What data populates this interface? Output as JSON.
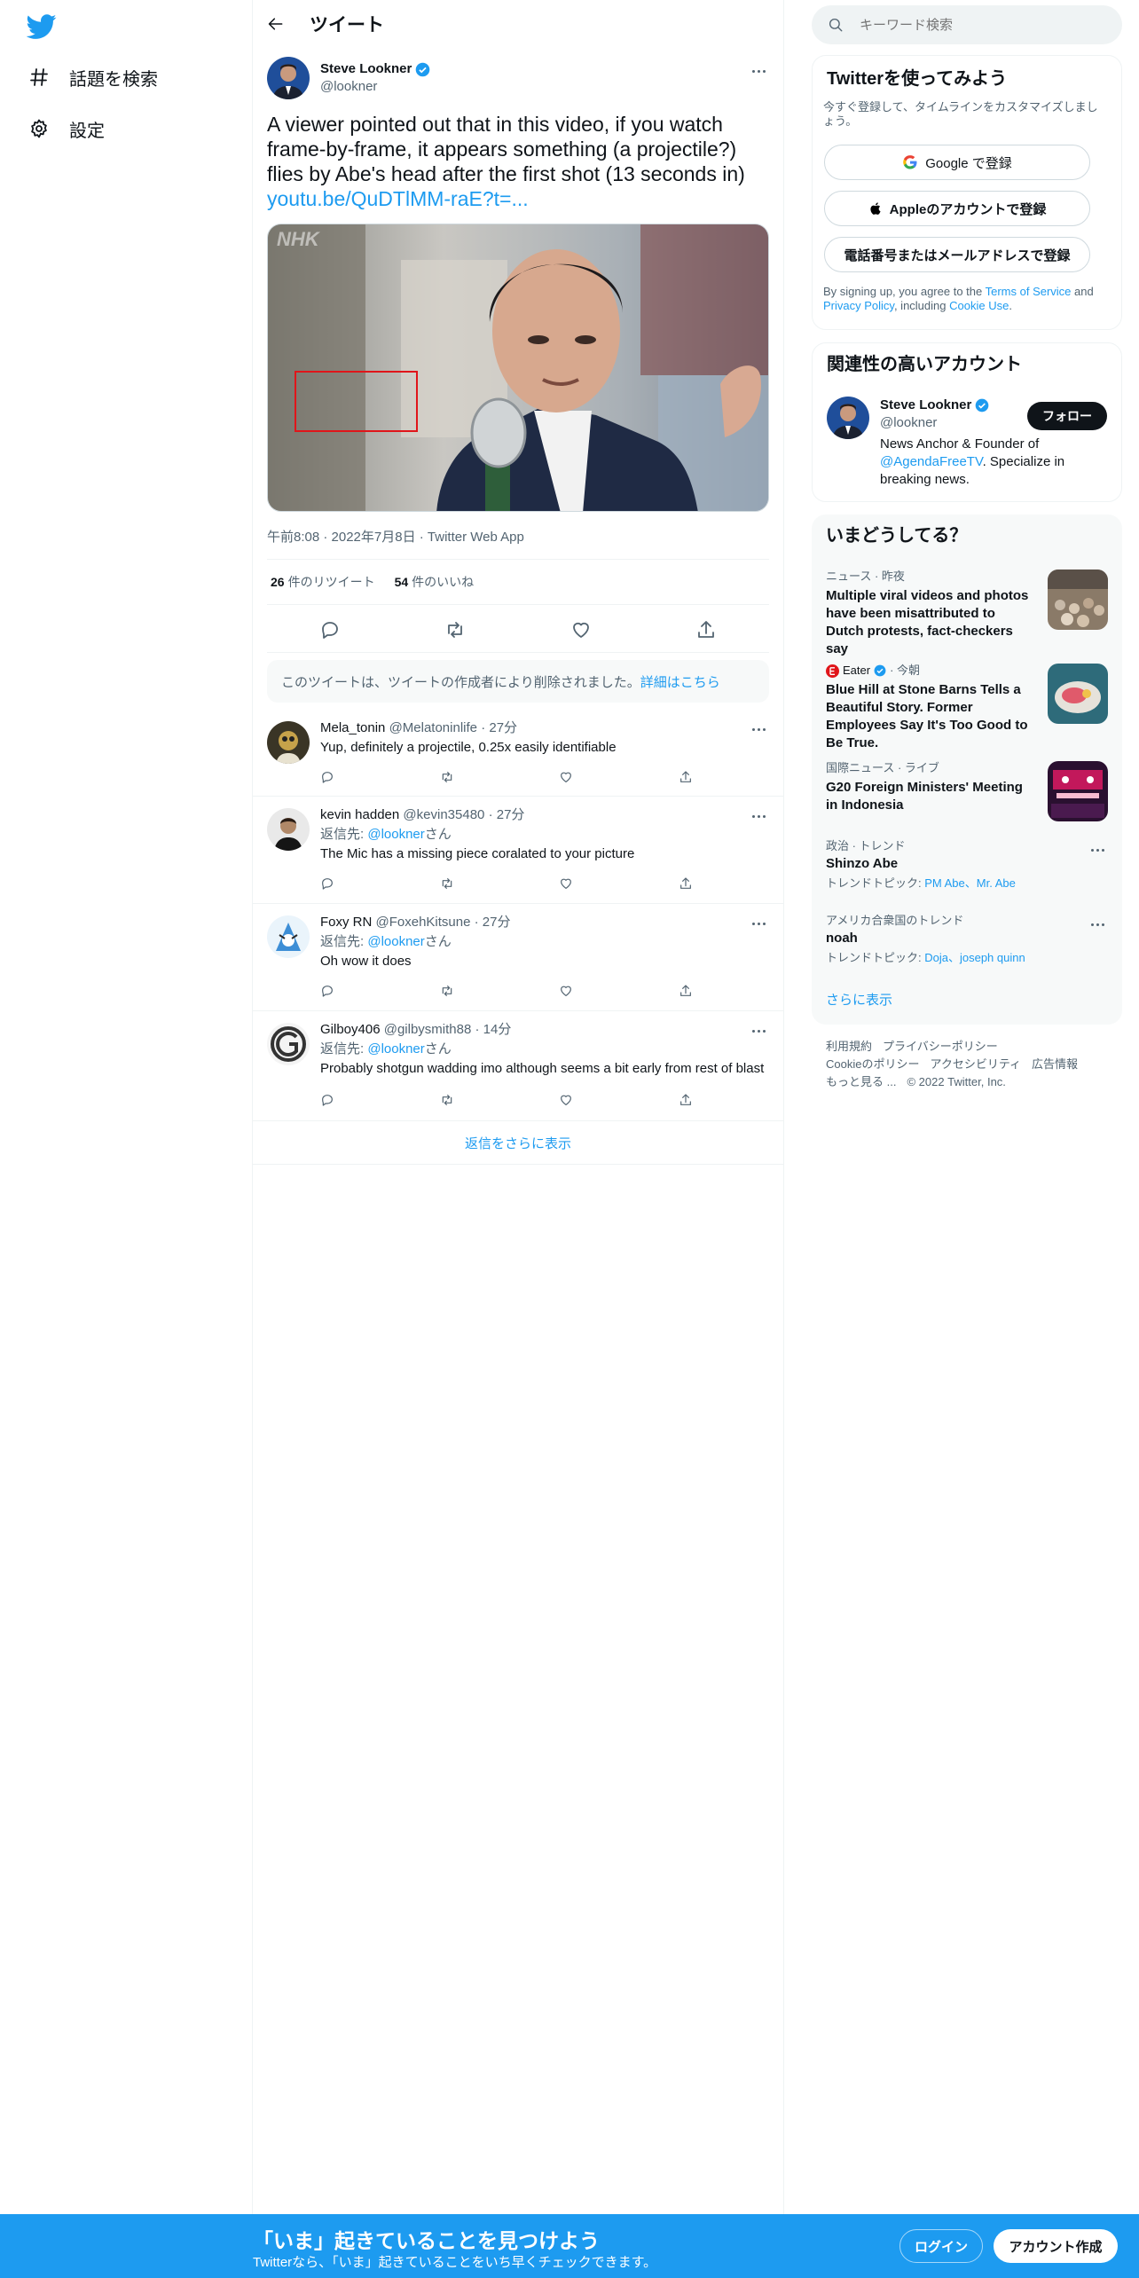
{
  "nav": {
    "explore_label": "話題を検索",
    "settings_label": "設定"
  },
  "header": {
    "title": "ツイート"
  },
  "tweet": {
    "author_name": "Steve Lookner",
    "author_handle": "@lookner",
    "text": "A viewer pointed out that in this video, if you watch frame-by-frame, it appears something (a projectile?) flies by Abe's head after the first shot (13 seconds in)",
    "link": "youtu.be/QuDTlMM-raE?t=...",
    "media_watermark": "NHK",
    "timestamp": "午前8:08 · 2022年7月8日 · Twitter Web App",
    "retweets_count": "26",
    "retweets_label": "件のリツイート",
    "likes_count": "54",
    "likes_label": "件のいいね"
  },
  "deleted_notice": {
    "text": "このツイートは、ツイートの作成者により削除されました。",
    "link": "詳細はこちら"
  },
  "replies": [
    {
      "name": "Mela_tonin",
      "handle": "@Melatoninlife",
      "time": "· 27分",
      "reply_to": "",
      "text": "Yup, definitely a projectile, 0.25x easily identifiable"
    },
    {
      "name": "kevin hadden",
      "handle": "@kevin35480",
      "time": "· 27分",
      "reply_to_prefix": "返信先: ",
      "reply_to": "@lookner",
      "reply_to_suffix": "さん",
      "text": "The Mic has a missing piece  coralated to your picture"
    },
    {
      "name": "Foxy RN",
      "handle": "@FoxehKitsune",
      "time": "· 27分",
      "reply_to_prefix": "返信先: ",
      "reply_to": "@lookner",
      "reply_to_suffix": "さん",
      "text": "Oh wow it does"
    },
    {
      "name": "Gilboy406",
      "handle": "@gilbysmith88",
      "time": "· 14分",
      "reply_to_prefix": "返信先: ",
      "reply_to": "@lookner",
      "reply_to_suffix": "さん",
      "text": "Probably shotgun wadding imo although seems a bit early from rest of blast"
    }
  ],
  "more_replies": "返信をさらに表示",
  "search": {
    "placeholder": "キーワード検索"
  },
  "signup_panel": {
    "title": "Twitterを使ってみよう",
    "subtitle": "今すぐ登録して、タイムラインをカスタマイズしましょう。",
    "google": "Google で登録",
    "apple": "Appleのアカウントで登録",
    "phone": "電話番号またはメールアドレスで登録",
    "terms_1": "By signing up, you agree to the ",
    "terms_link": "Terms of Service",
    "terms_2": " and ",
    "privacy_link": "Privacy Policy",
    "terms_3": ", including ",
    "cookie_link": "Cookie Use",
    "terms_4": "."
  },
  "relevant": {
    "title": "関連性の高いアカウント",
    "name": "Steve Lookner",
    "handle": "@lookner",
    "follow": "フォロー",
    "bio_1": "News Anchor & Founder of ",
    "bio_link": "@AgendaFreeTV",
    "bio_2": ". Specialize in breaking news."
  },
  "trends": {
    "title": "いまどうしてる？",
    "items": [
      {
        "context": "ニュース · 昨夜",
        "title": "Multiple viral videos and photos have been misattributed to Dutch protests, fact-checkers say"
      },
      {
        "context_source": "Eater",
        "context": " · 今朝",
        "title": "Blue Hill at Stone Barns Tells a Beautiful Story. Former Employees Say It's Too Good to Be True."
      },
      {
        "context": "国際ニュース · ライブ",
        "title": "G20 Foreign Ministers' Meeting in Indonesia"
      },
      {
        "context": "政治 · トレンド",
        "title": "Shinzo Abe",
        "topics_label": "トレンドトピック: ",
        "topics": "PM Abe、Mr. Abe"
      },
      {
        "context": "アメリカ合衆国のトレンド",
        "title": "noah",
        "topics_label": "トレンドトピック: ",
        "topics": "Doja、joseph quinn"
      }
    ],
    "show_more": "さらに表示"
  },
  "footer": {
    "line1": [
      "利用規約",
      "プライバシーポリシー"
    ],
    "line2": [
      "Cookieのポリシー",
      "アクセシビリティ",
      "広告情報"
    ],
    "line3_more": "もっと見る ...",
    "copyright": "© 2022 Twitter, Inc."
  },
  "bottom_bar": {
    "headline": "「いま」起きていることを見つけよう",
    "sub": "Twitterなら、「いま」起きていることをいち早くチェックできます。",
    "login": "ログイン",
    "signup": "アカウント作成"
  },
  "colors": {
    "accent": "#1d9bf0",
    "text": "#0f1419",
    "muted": "#536471",
    "border": "#eff3f4",
    "highlight_box": "#e0151a"
  }
}
